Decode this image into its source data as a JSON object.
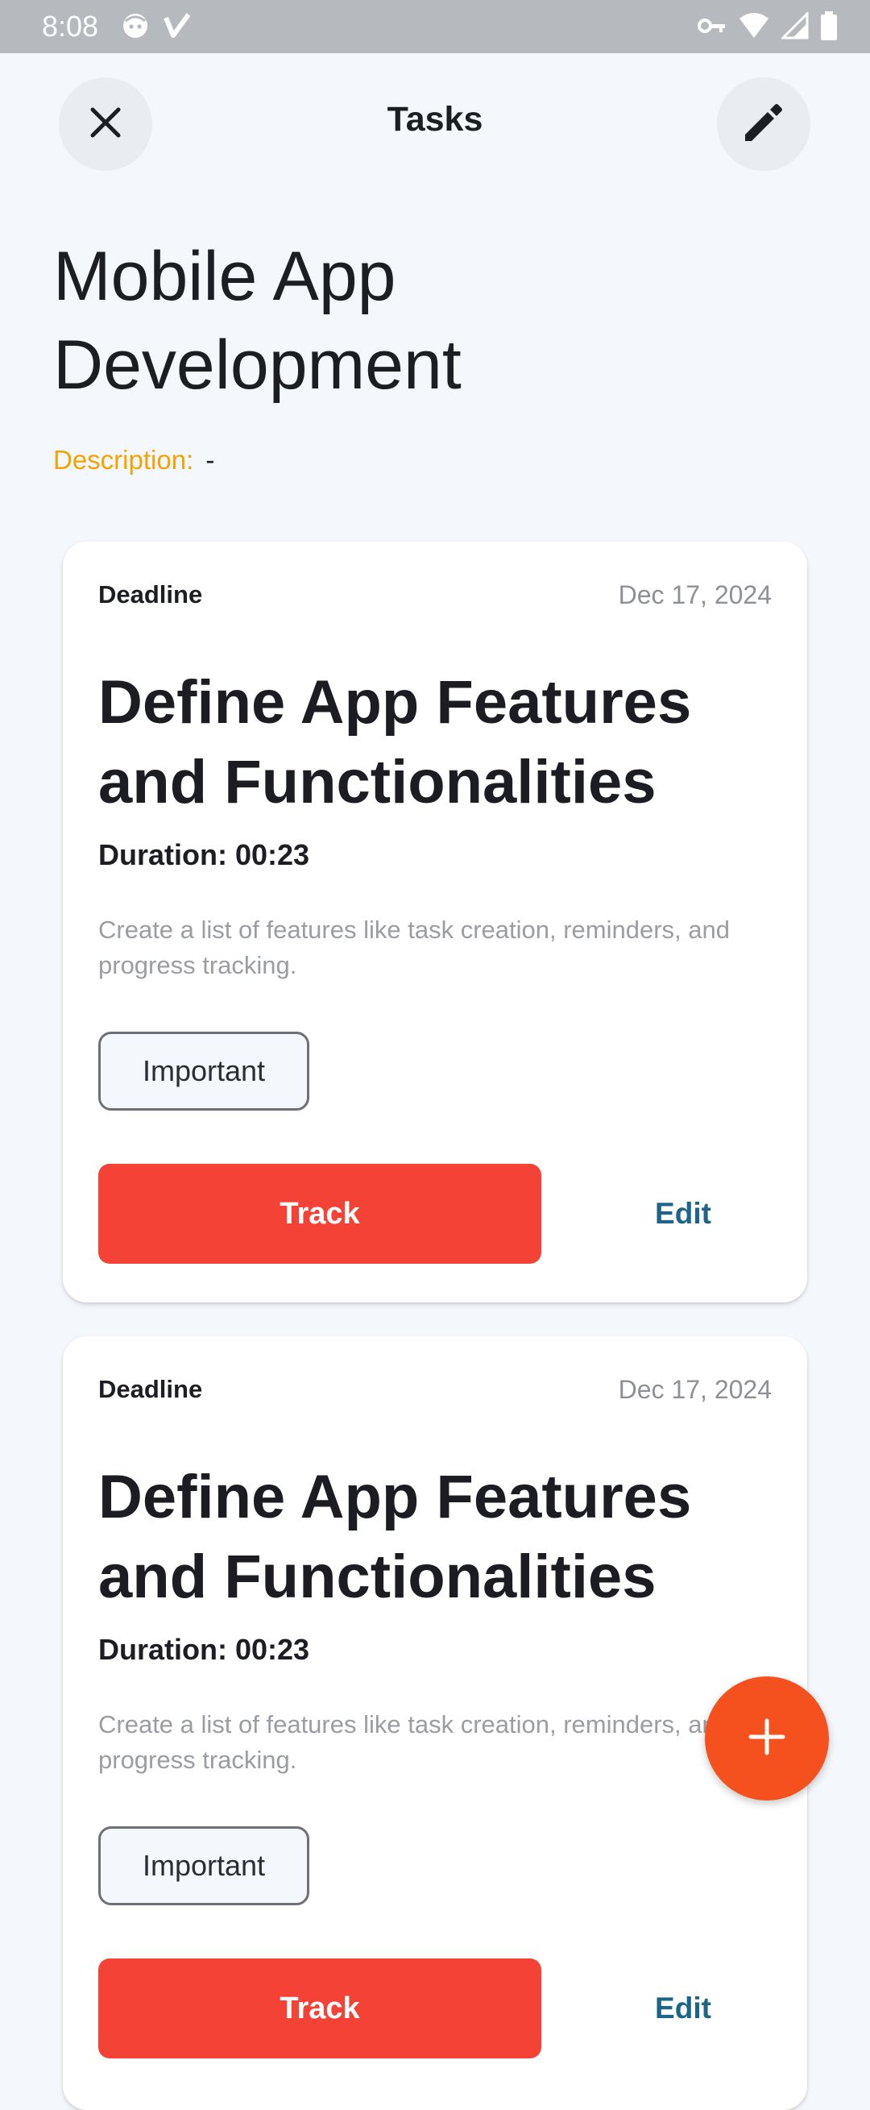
{
  "status_bar": {
    "time": "8:08"
  },
  "app_bar": {
    "title": "Tasks",
    "close_icon": "close-icon",
    "edit_icon": "pencil-icon"
  },
  "project": {
    "title": "Mobile App Development",
    "description_label": "Description:",
    "description_value": "-"
  },
  "tasks": [
    {
      "deadline_label": "Deadline",
      "deadline_date": "Dec 17, 2024",
      "title": "Define App Features and Functionalities",
      "duration": "Duration: 00:23",
      "description": "Create a list of features like task creation, reminders, and progress tracking.",
      "priority": "Important",
      "track_label": "Track",
      "edit_label": "Edit"
    },
    {
      "deadline_label": "Deadline",
      "deadline_date": "Dec 17, 2024",
      "title": "Define App Features and Functionalities",
      "duration": "Duration: 00:23",
      "description": "Create a list of features like task creation, reminders, and progress tracking.",
      "priority": "Important",
      "track_label": "Track",
      "edit_label": "Edit"
    }
  ],
  "fab": {
    "icon": "plus-icon"
  },
  "colors": {
    "accent_orange": "#f5a300",
    "track_red": "#f44336",
    "fab_orange": "#f4511e",
    "edit_blue": "#1d6488",
    "background": "#f4f7fb"
  }
}
